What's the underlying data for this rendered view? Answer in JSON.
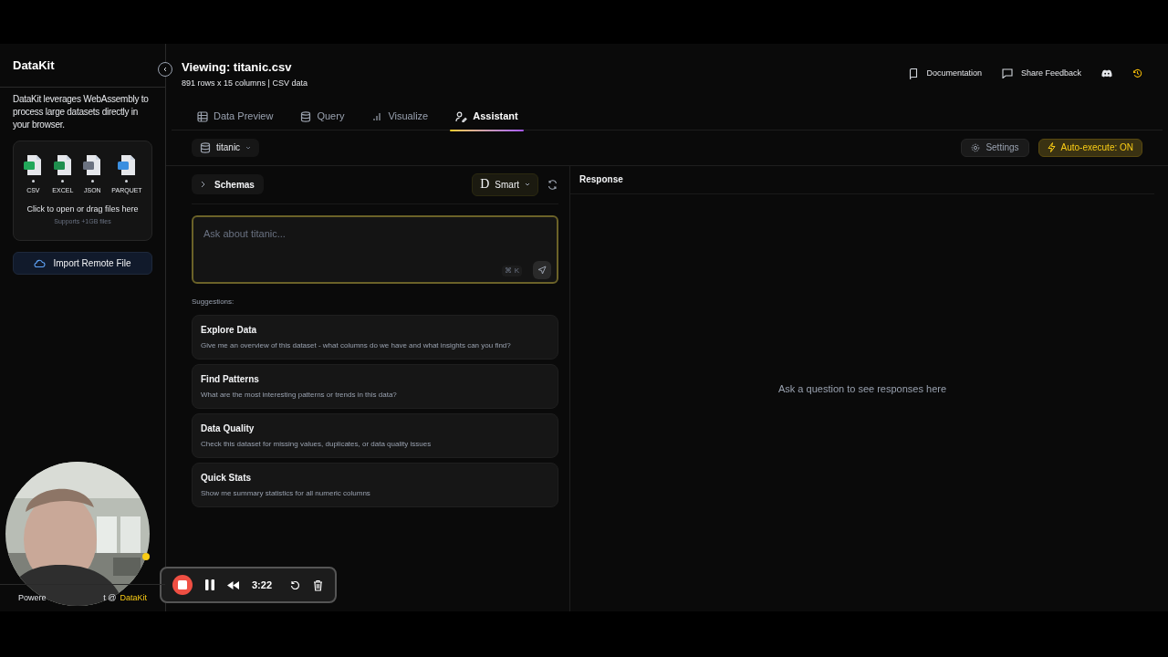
{
  "sidebar": {
    "brand": "DataKit",
    "description": "DataKit leverages WebAssembly to process large datasets directly in your browser.",
    "file_types": [
      {
        "label": "CSV",
        "color": "#22a85a"
      },
      {
        "label": "EXCEL",
        "color": "#1f8f4e"
      },
      {
        "label": "JSON",
        "color": "#6b7280"
      },
      {
        "label": "PARQUET",
        "color": "#3b8fe0"
      }
    ],
    "drop_text": "Click to open or drag files here",
    "drop_hint": "Supports +1GB files",
    "import_button": "Import Remote File",
    "footer": {
      "lead": "Powere",
      "tail": "t @",
      "link": "DataKit"
    }
  },
  "header": {
    "title": "Viewing: titanic.csv",
    "subtitle": "891 rows x 15 columns | CSV data",
    "links": [
      "Documentation",
      "Share Feedback"
    ]
  },
  "tabs": [
    {
      "label": "Data Preview",
      "selected": false
    },
    {
      "label": "Query",
      "selected": false
    },
    {
      "label": "Visualize",
      "selected": false
    },
    {
      "label": "Assistant",
      "selected": true
    }
  ],
  "toolbar": {
    "dataset": "titanic",
    "settings": "Settings",
    "auto_execute": {
      "label": "Auto-execute: ON",
      "on": true
    }
  },
  "assistant": {
    "schemas": "Schemas",
    "model": "Smart",
    "model_logo": "D",
    "input": {
      "placeholder": "Ask about titanic..."
    },
    "shortcut": "⌘ K",
    "suggestions_label": "Suggestions:",
    "suggestions": [
      {
        "title": "Explore Data",
        "text": "Give me an overview of this dataset - what columns do we have and what insights can you find?"
      },
      {
        "title": "Find Patterns",
        "text": "What are the most interesting patterns or trends in this data?"
      },
      {
        "title": "Data Quality",
        "text": "Check this dataset for missing values, duplicates, or data quality issues"
      },
      {
        "title": "Quick Stats",
        "text": "Show me summary statistics for all numeric columns"
      }
    ]
  },
  "response": {
    "title": "Response",
    "empty": "Ask a question to see responses here"
  },
  "recorder": {
    "time": "3:22"
  }
}
